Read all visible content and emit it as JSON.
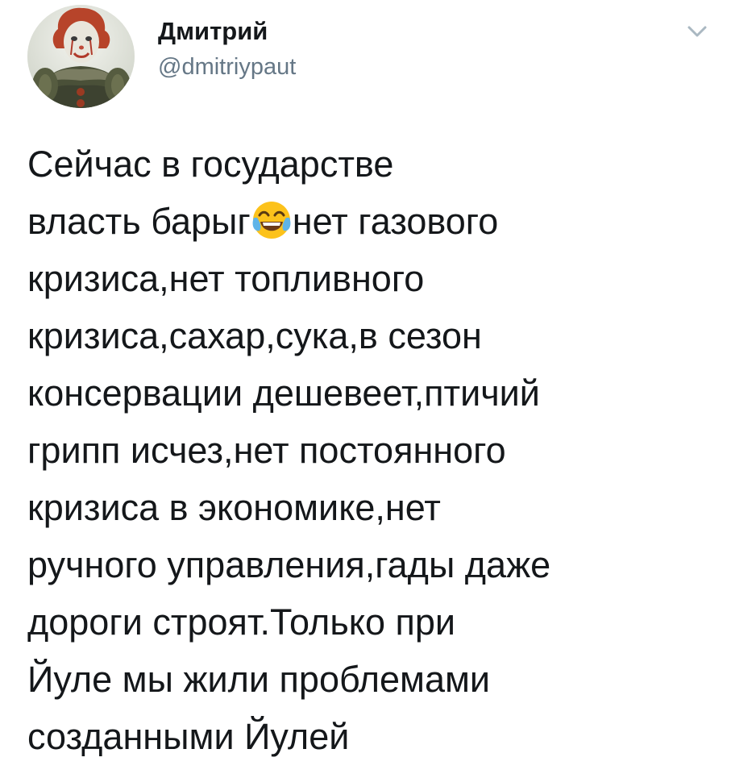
{
  "author": {
    "display_name": "Дмитрий",
    "handle": "@dmitriypaut",
    "avatar_icon": "clown-avatar"
  },
  "menu": {
    "icon": "chevron-down-icon",
    "color": "#aab8c2"
  },
  "tweet": {
    "line_1": "Сейчас в государстве",
    "line_2_before": "власть барыг",
    "line_2_emoji": "face-with-tears-of-joy-emoji",
    "line_2_after": "нет газового",
    "line_3": "кризиса,нет топливного",
    "line_4": "кризиса,сахар,сука,в сезон",
    "line_5": "консервации дешевеет,птичий",
    "line_6": "грипп исчез,нет постоянного",
    "line_7": "кризиса в экономике,нет",
    "line_8": "ручного управления,гады даже",
    "line_9": "дороги строят.Только при",
    "line_10": "Йуле мы жили проблемами",
    "line_11": "созданными Йулей"
  },
  "colors": {
    "text": "#14171a",
    "secondary": "#657786"
  }
}
